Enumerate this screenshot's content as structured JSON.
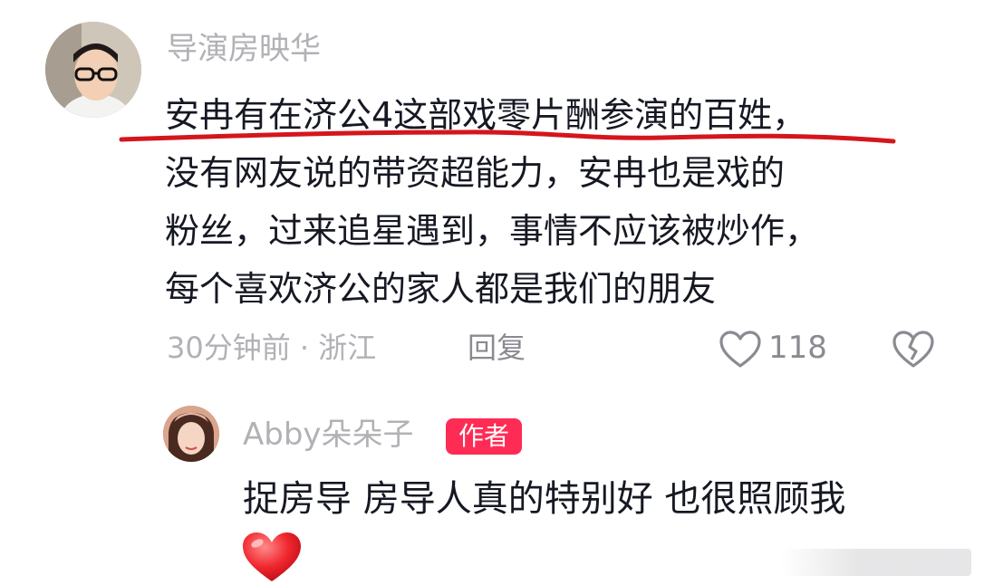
{
  "main_comment": {
    "username": "导演房映华",
    "lines": [
      "安冉有在济公4这部戏零片酬参演的百姓，",
      "没有网友说的带资超能力，安冉也是戏的",
      "粉丝，过来追星遇到，事情不应该被炒作，",
      "每个喜欢济公的家人都是我们的朋友"
    ],
    "time_location": "30分钟前 · 浙江",
    "reply_label": "回复",
    "like_count": "118",
    "underline_color": "#d4161c"
  },
  "reply_comment": {
    "username": "Abby朵朵子",
    "badge": "作者",
    "badge_color": "#fe2c55",
    "text": "捉房导 房导人真的特别好 也很照顾我",
    "emoji": "red-heart"
  },
  "icons": {
    "like": "heart-outline-icon",
    "dislike": "broken-heart-icon"
  }
}
